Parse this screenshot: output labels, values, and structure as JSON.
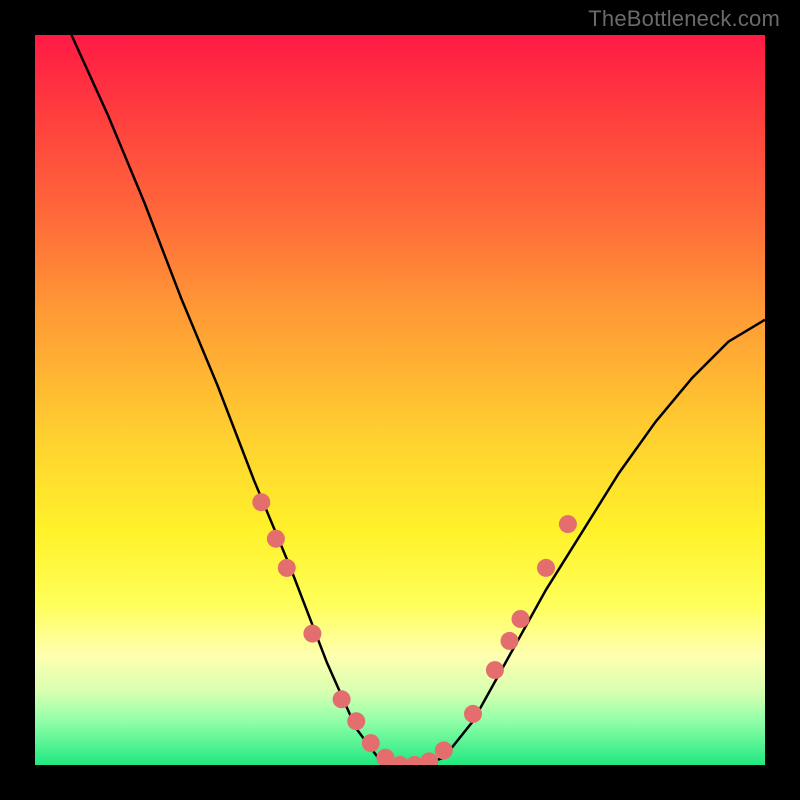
{
  "watermark": {
    "text": "TheBottleneck.com"
  },
  "colors": {
    "background": "#000000",
    "curve": "#000000",
    "curveWidth": 2.5,
    "marker": "#e46e6e",
    "markerRadius": 9,
    "gradientStops": [
      {
        "pos": 0,
        "color": "#ff1a44"
      },
      {
        "pos": 10,
        "color": "#ff3b3f"
      },
      {
        "pos": 25,
        "color": "#ff6a3a"
      },
      {
        "pos": 38,
        "color": "#ff9a35"
      },
      {
        "pos": 55,
        "color": "#ffd030"
      },
      {
        "pos": 68,
        "color": "#fff22a"
      },
      {
        "pos": 78,
        "color": "#ffff5a"
      },
      {
        "pos": 85,
        "color": "#ffffb0"
      },
      {
        "pos": 90,
        "color": "#d8ffb0"
      },
      {
        "pos": 94,
        "color": "#90ffa8"
      },
      {
        "pos": 100,
        "color": "#20e880"
      }
    ]
  },
  "chart_data": {
    "type": "line",
    "title": "",
    "xlabel": "",
    "ylabel": "",
    "xlim": [
      0,
      100
    ],
    "ylim": [
      0,
      100
    ],
    "grid": false,
    "legend": false,
    "description": "V-shaped bottleneck curve. x is an abstract match/ratio scale; y is bottleneck % (0 at trough). Unlabeled axes; values read from pixel geometry.",
    "series": [
      {
        "name": "bottleneck-curve",
        "x": [
          5,
          10,
          15,
          20,
          25,
          30,
          35,
          40,
          44,
          47,
          50,
          53,
          56,
          60,
          65,
          70,
          75,
          80,
          85,
          90,
          95,
          100
        ],
        "y": [
          100,
          89,
          77,
          64,
          52,
          39,
          27,
          14,
          5,
          1,
          0,
          0,
          1,
          6,
          15,
          24,
          32,
          40,
          47,
          53,
          58,
          61
        ]
      }
    ],
    "trough": {
      "x_range": [
        47,
        55
      ],
      "y": 0
    },
    "markers": {
      "name": "highlight-points",
      "note": "Pink dots clustered near the bottom of the V on both branches.",
      "points": [
        {
          "x": 31,
          "y": 36
        },
        {
          "x": 33,
          "y": 31
        },
        {
          "x": 34.5,
          "y": 27
        },
        {
          "x": 38,
          "y": 18
        },
        {
          "x": 42,
          "y": 9
        },
        {
          "x": 44,
          "y": 6
        },
        {
          "x": 46,
          "y": 3
        },
        {
          "x": 48,
          "y": 1
        },
        {
          "x": 50,
          "y": 0
        },
        {
          "x": 52,
          "y": 0
        },
        {
          "x": 54,
          "y": 0.5
        },
        {
          "x": 56,
          "y": 2
        },
        {
          "x": 60,
          "y": 7
        },
        {
          "x": 63,
          "y": 13
        },
        {
          "x": 65,
          "y": 17
        },
        {
          "x": 66.5,
          "y": 20
        },
        {
          "x": 70,
          "y": 27
        },
        {
          "x": 73,
          "y": 33
        }
      ]
    }
  }
}
